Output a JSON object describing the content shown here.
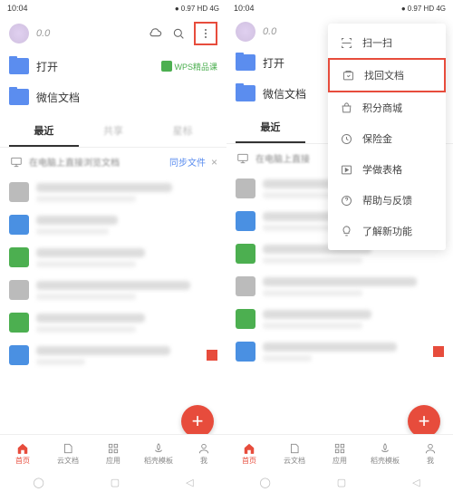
{
  "status": {
    "time": "10:04",
    "right": "0.97 HD 4G"
  },
  "header": {
    "score": "0.0"
  },
  "folders": [
    {
      "label": "打开",
      "badge": "WPS精品课"
    },
    {
      "label": "微信文档"
    }
  ],
  "tabs": [
    "最近",
    "共享",
    "星标"
  ],
  "tip": {
    "text": "在电脑上直接浏览文档",
    "action": "同步文件",
    "close": "×"
  },
  "menu": [
    {
      "icon": "scan",
      "label": "扫一扫"
    },
    {
      "icon": "recover",
      "label": "找回文档",
      "highlight": true
    },
    {
      "icon": "mall",
      "label": "积分商城"
    },
    {
      "icon": "safe",
      "label": "保险金"
    },
    {
      "icon": "templates",
      "label": "学做表格"
    },
    {
      "icon": "help",
      "label": "帮助与反馈"
    },
    {
      "icon": "new",
      "label": "了解新功能"
    }
  ],
  "nav": [
    "首页",
    "云文档",
    "应用",
    "稻壳模板",
    "我"
  ],
  "fab": "+"
}
